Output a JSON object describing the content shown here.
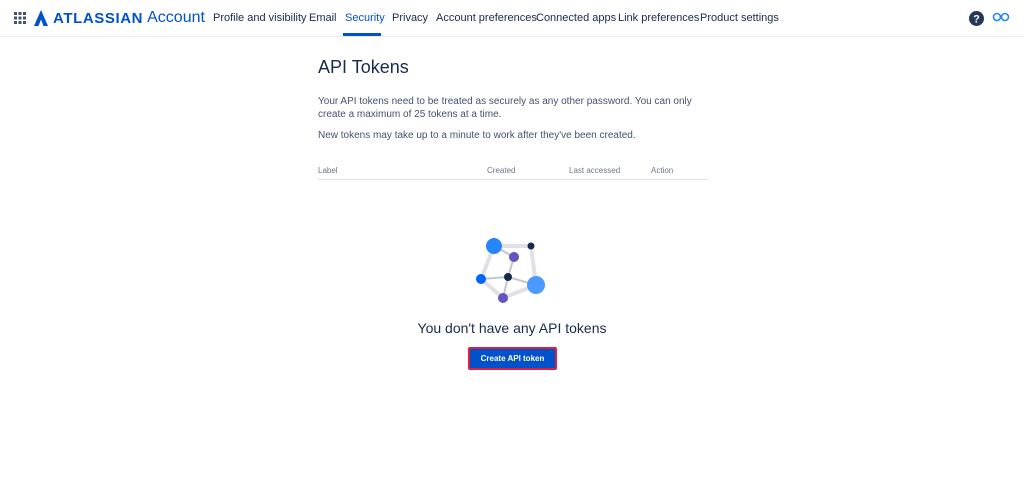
{
  "header": {
    "brand": "ATLASSIAN",
    "product": "Account",
    "nav": [
      {
        "label": "Profile and visibility"
      },
      {
        "label": "Email"
      },
      {
        "label": "Security"
      },
      {
        "label": "Privacy"
      },
      {
        "label": "Account preferences"
      },
      {
        "label": "Connected apps"
      },
      {
        "label": "Link preferences"
      },
      {
        "label": "Product settings"
      }
    ],
    "active_tab": "Security"
  },
  "main": {
    "title": "API Tokens",
    "description_1": "Your API tokens need to be treated as securely as any other password. You can only create a maximum of 25 tokens at a time.",
    "description_2": "New tokens may take up to a minute to work after they've been created.",
    "table_headers": [
      "Label",
      "Created",
      "Last accessed",
      "Action"
    ],
    "empty_title": "You don't have any API tokens",
    "create_button": "Create API token"
  },
  "colors": {
    "brand_blue": "#0052cc",
    "text_dark": "#172b4d",
    "highlight_border": "#e01f3d"
  },
  "icons": [
    "app-switcher-icon",
    "atlassian-logo-icon",
    "help-icon",
    "profile-icon"
  ]
}
